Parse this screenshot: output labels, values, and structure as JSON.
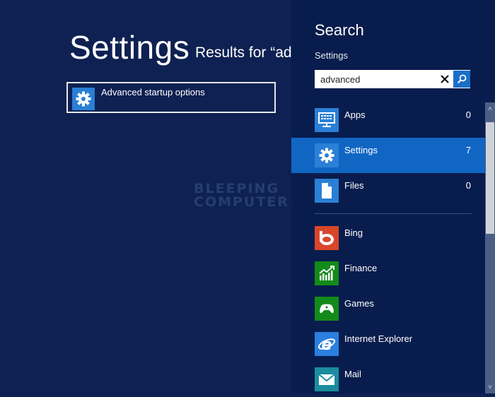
{
  "main": {
    "title": "Settings",
    "results_for": "Results for “ad",
    "results": [
      {
        "label": "Advanced startup options",
        "icon": "gear-icon"
      }
    ],
    "watermark": [
      "BLEEPING",
      "COMPUTER"
    ]
  },
  "charm": {
    "title": "Search",
    "scope_label": "Settings",
    "search": {
      "value": "advanced",
      "clear_icon": "close-icon",
      "go_icon": "search-icon"
    },
    "scopes": [
      {
        "name": "Apps",
        "count": "0",
        "icon": "monitor-keyboard-icon",
        "color": "#2a7fd6"
      },
      {
        "name": "Settings",
        "count": "7",
        "icon": "gear-icon",
        "color": "#2a7fd6",
        "selected": true
      },
      {
        "name": "Files",
        "count": "0",
        "icon": "document-icon",
        "color": "#2a7fd6"
      }
    ],
    "apps": [
      {
        "name": "Bing",
        "icon": "bing-icon",
        "color": "#d9462a"
      },
      {
        "name": "Finance",
        "icon": "finance-chart-icon",
        "color": "#138a1a"
      },
      {
        "name": "Games",
        "icon": "gamepad-icon",
        "color": "#138a1a"
      },
      {
        "name": "Internet Explorer",
        "icon": "internet-explorer-icon",
        "color": "#2a7fe0"
      },
      {
        "name": "Mail",
        "icon": "mail-icon",
        "color": "#1a8c9e"
      }
    ],
    "scrollbar": {
      "up_glyph": "˄",
      "down_glyph": "˅"
    }
  },
  "colors": {
    "background": "#0e2152",
    "charm_background": "#081d4d",
    "selected": "#1166c4",
    "accent": "#2a7fd6"
  }
}
